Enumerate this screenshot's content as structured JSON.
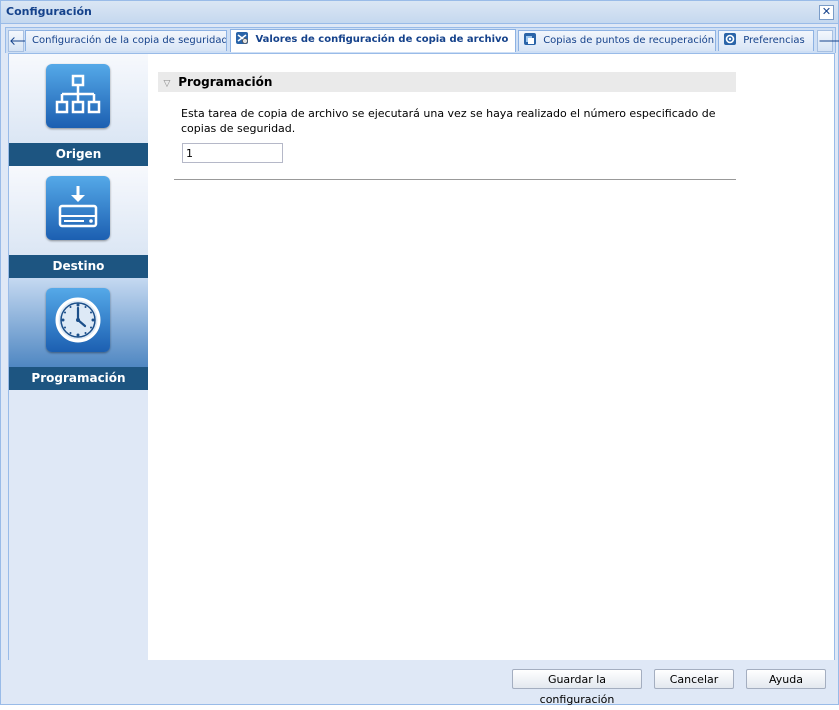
{
  "window": {
    "title": "Configuración"
  },
  "tabs": [
    {
      "label": "Configuración de la copia de seguridad",
      "active": false,
      "icon": ""
    },
    {
      "label": "Valores de configuración de copia de archivo",
      "active": true,
      "icon": "file-copy-icon"
    },
    {
      "label": "Copias de puntos de recuperación",
      "active": false,
      "icon": "recovery-points-icon"
    },
    {
      "label": "Preferencias",
      "active": false,
      "icon": "preferences-gear-icon"
    }
  ],
  "sidebar": {
    "items": [
      {
        "label": "Origen",
        "icon": "source-hierarchy-icon",
        "selected": false
      },
      {
        "label": "Destino",
        "icon": "destination-drive-icon",
        "selected": false
      },
      {
        "label": "Programación",
        "icon": "schedule-clock-icon",
        "selected": true
      }
    ]
  },
  "section": {
    "title": "Programación",
    "description": "Esta tarea de copia de archivo se ejecutará una vez se haya realizado el número especificado de copias de seguridad.",
    "count_value": "1"
  },
  "footer": {
    "save_label": "Guardar la configuración",
    "cancel_label": "Cancelar",
    "help_label": "Ayuda"
  },
  "colors": {
    "title_text": "#15428b",
    "nav_caption_bg": "#1d5581",
    "tile_gradient_top": "#55a9e8",
    "tile_gradient_bottom": "#1c5fb1"
  }
}
